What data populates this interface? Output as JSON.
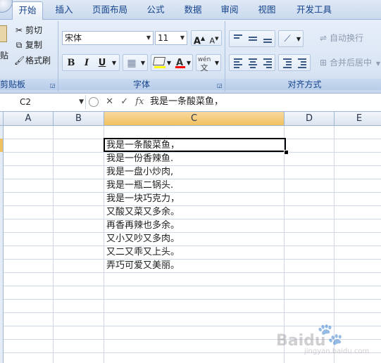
{
  "tabs": [
    "开始",
    "插入",
    "页面布局",
    "公式",
    "数据",
    "审阅",
    "视图",
    "开发工具"
  ],
  "ribbon": {
    "clipboard": {
      "paste_label": "贴",
      "cut_label": "剪切",
      "copy_label": "复制",
      "format_painter_label": "格式刷",
      "group_label": "剪贴板"
    },
    "font": {
      "font_name": "宋体",
      "font_size": "11",
      "bold": "B",
      "italic": "I",
      "underline": "U",
      "font_color_letter": "A",
      "phonetic_label": "wén",
      "grow_label": "A",
      "shrink_label": "A",
      "group_label": "字体"
    },
    "alignment": {
      "wrap_text_label": "自动换行",
      "merge_center_label": "合并后居中",
      "group_label": "对齐方式"
    }
  },
  "formula_bar": {
    "name_box": "C2",
    "fx_label": "fx",
    "content": "我是一条酸菜鱼，"
  },
  "columns": [
    "A",
    "B",
    "C",
    "D",
    "E"
  ],
  "cells": [
    "我是一条酸菜鱼，",
    "我是一份香辣鱼.",
    "我是一盘小炒肉,",
    "我是一瓶二锅头.",
    "我是一块巧克力，",
    "又酸又菜又多余。",
    "再香再辣也多余。",
    "又小又吵又多肉。",
    "又二又乖又上头。",
    "弄巧可爱又美丽。"
  ],
  "watermark": {
    "text": "Baidu",
    "sub": "jingyan.baidu.com"
  },
  "colors": {
    "ribbon": "#dbe6f4",
    "tab_text": "#15428b",
    "selected_header": "#f1c15f"
  }
}
